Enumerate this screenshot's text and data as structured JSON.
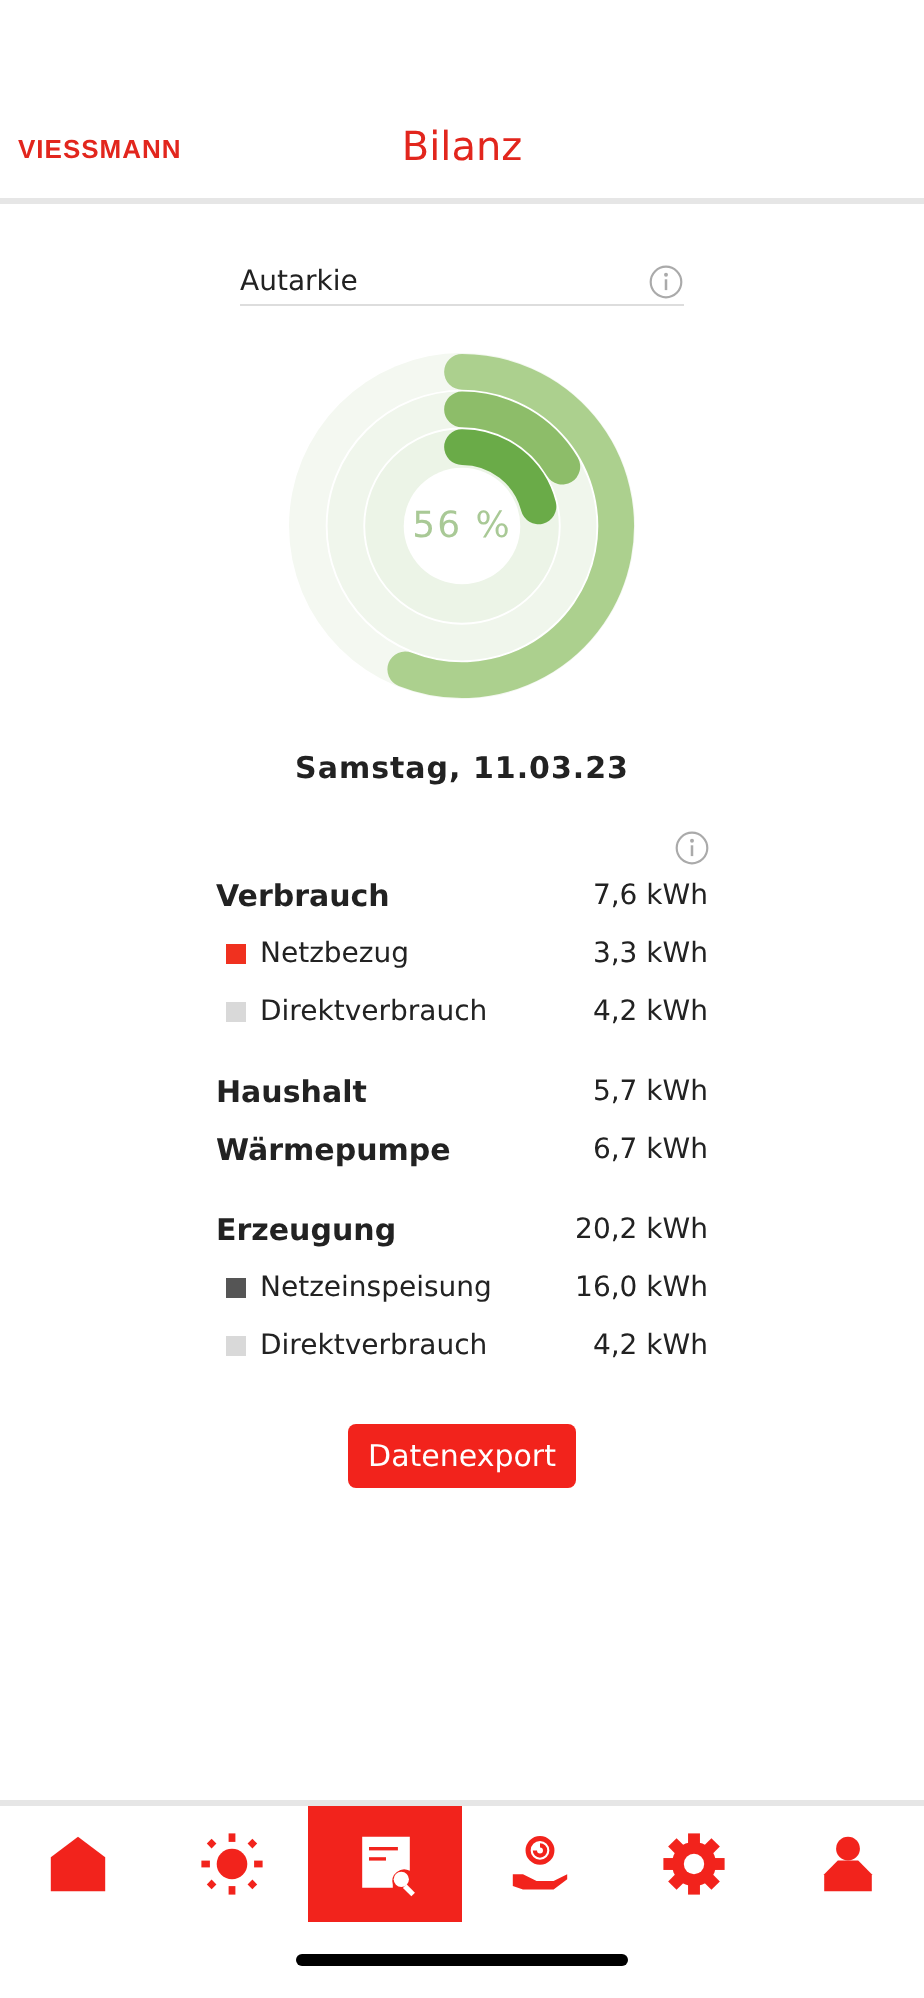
{
  "header": {
    "logo": "VIESSMANN",
    "title": "Bilanz"
  },
  "selector": {
    "value": "Autarkie"
  },
  "ring_chart": {
    "center_label": "56 %"
  },
  "date": "Samstag, 11.03.23",
  "groups": [
    {
      "rows": [
        {
          "kind": "total",
          "label": "Verbrauch",
          "value": "7,6 kWh"
        },
        {
          "kind": "legend",
          "label": "Netzbezug",
          "value": "3,3 kWh",
          "color": "#f0311f"
        },
        {
          "kind": "legend",
          "label": "Direktverbrauch",
          "value": "4,2 kWh",
          "color": "#d9d9d9"
        }
      ]
    },
    {
      "rows": [
        {
          "kind": "total",
          "label": "Haushalt",
          "value": "5,7 kWh"
        },
        {
          "kind": "total",
          "label": "Wärmepumpe",
          "value": "6,7 kWh"
        }
      ]
    },
    {
      "rows": [
        {
          "kind": "total",
          "label": "Erzeugung",
          "value": "20,2 kWh"
        },
        {
          "kind": "legend",
          "label": "Netzeinspeisung",
          "value": "16,0 kWh",
          "color": "#555555"
        },
        {
          "kind": "legend",
          "label": "Direktverbrauch",
          "value": "4,2 kWh",
          "color": "#d9d9d9"
        }
      ]
    }
  ],
  "export_button": "Datenexport",
  "tabs": [
    {
      "selected": false
    },
    {
      "selected": false
    },
    {
      "selected": true
    },
    {
      "selected": false
    },
    {
      "selected": false
    },
    {
      "selected": false
    }
  ]
}
